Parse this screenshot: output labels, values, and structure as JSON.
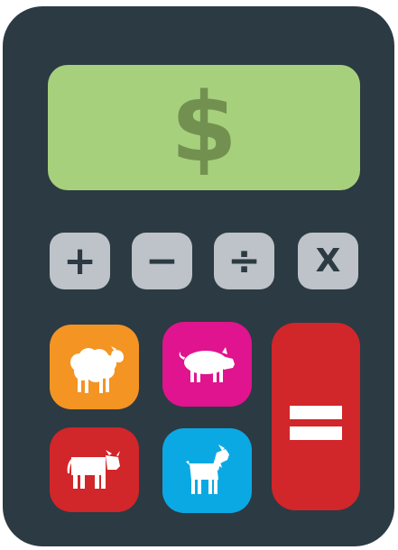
{
  "display": {
    "symbol": "$",
    "background": "#a6d07c",
    "symbol_color": "#72904f"
  },
  "body_color": "#2c3a43",
  "operators": [
    {
      "label": "+",
      "name": "plus"
    },
    {
      "label": "−",
      "name": "minus"
    },
    {
      "label": "÷",
      "name": "divide"
    },
    {
      "label": "X",
      "name": "multiply"
    }
  ],
  "animal_keys": [
    {
      "animal": "sheep",
      "icon": "sheep-icon",
      "color": "#f49423"
    },
    {
      "animal": "pig",
      "icon": "pig-icon",
      "color": "#e0148e"
    },
    {
      "animal": "cow",
      "icon": "cow-icon",
      "color": "#d1262a"
    },
    {
      "animal": "goat",
      "icon": "goat-icon",
      "color": "#0ba9e3"
    }
  ],
  "equals_key": {
    "icon": "equals-icon",
    "color": "#d1262a"
  }
}
